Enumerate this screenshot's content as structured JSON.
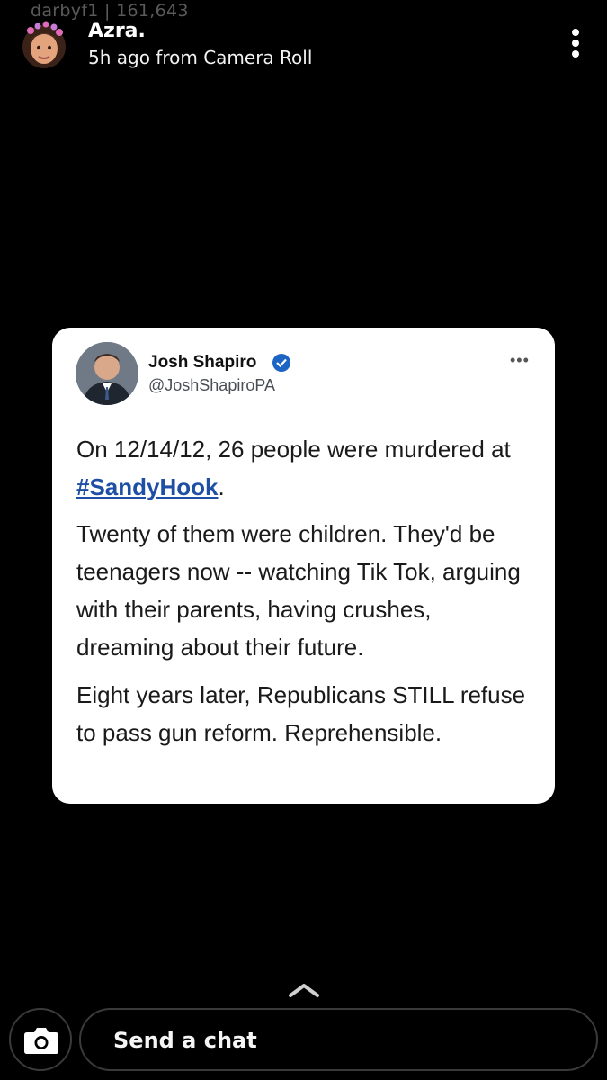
{
  "watermark": {
    "text": "darbyf1 | 161,643"
  },
  "story": {
    "author": "Azra.",
    "meta": "5h ago from Camera Roll",
    "avatar_icon": "bitmoji-avatar-icon",
    "menu_icon": "vertical-ellipsis-icon"
  },
  "tweet": {
    "name": "Josh Shapiro",
    "handle": "@JoshShapiroPA",
    "verified_icon": "verified-badge-icon",
    "more_label": "•••",
    "p1_before": "On 12/14/12, 26 people were murdered at ",
    "hashtag": "#SandyHook",
    "p1_after": ".",
    "p2": "Twenty of them were children. They'd be teenagers now -- watching Tik Tok, arguing with their parents, having crushes, dreaming about their future.",
    "p3": "Eight years later, Republicans STILL refuse to pass gun reform. Reprehensible."
  },
  "footer": {
    "swipe_icon": "chevron-up-icon",
    "camera_icon": "camera-icon",
    "chat_placeholder": "Send a chat"
  },
  "colors": {
    "background": "#000000",
    "card": "#ffffff",
    "hashtag": "#1f4fa5",
    "verified": "#1d65c4"
  }
}
